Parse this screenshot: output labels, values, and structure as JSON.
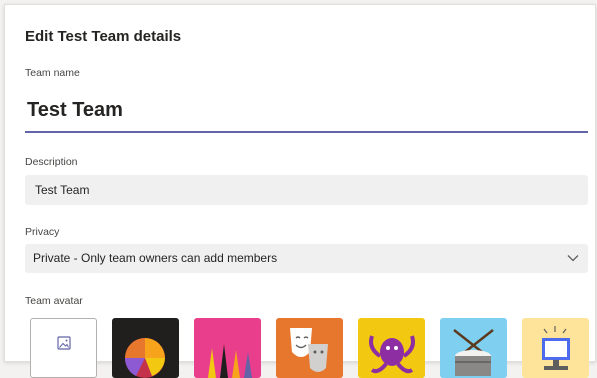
{
  "dialog": {
    "title": "Edit Test Team details"
  },
  "team_name": {
    "label": "Team name",
    "value": "Test Team"
  },
  "description": {
    "label": "Description",
    "value": "Test Team"
  },
  "privacy": {
    "label": "Privacy",
    "selected": "Private - Only team owners can add members"
  },
  "avatar": {
    "label": "Team avatar",
    "options": [
      {
        "icon": "upload-image-icon",
        "color": "#ffffff"
      },
      {
        "icon": "pie-chart-icon",
        "color": "#201f1e"
      },
      {
        "icon": "crayons-icon",
        "color": "#e83e8c"
      },
      {
        "icon": "theater-masks-icon",
        "color": "#e8772e"
      },
      {
        "icon": "octopus-icon",
        "color": "#f2c811"
      },
      {
        "icon": "drum-icon",
        "color": "#7fd0f0"
      },
      {
        "icon": "computer-icon",
        "color": "#fde49a"
      }
    ]
  },
  "colors": {
    "accent": "#6264a7",
    "input_background": "#f0f0f0"
  }
}
